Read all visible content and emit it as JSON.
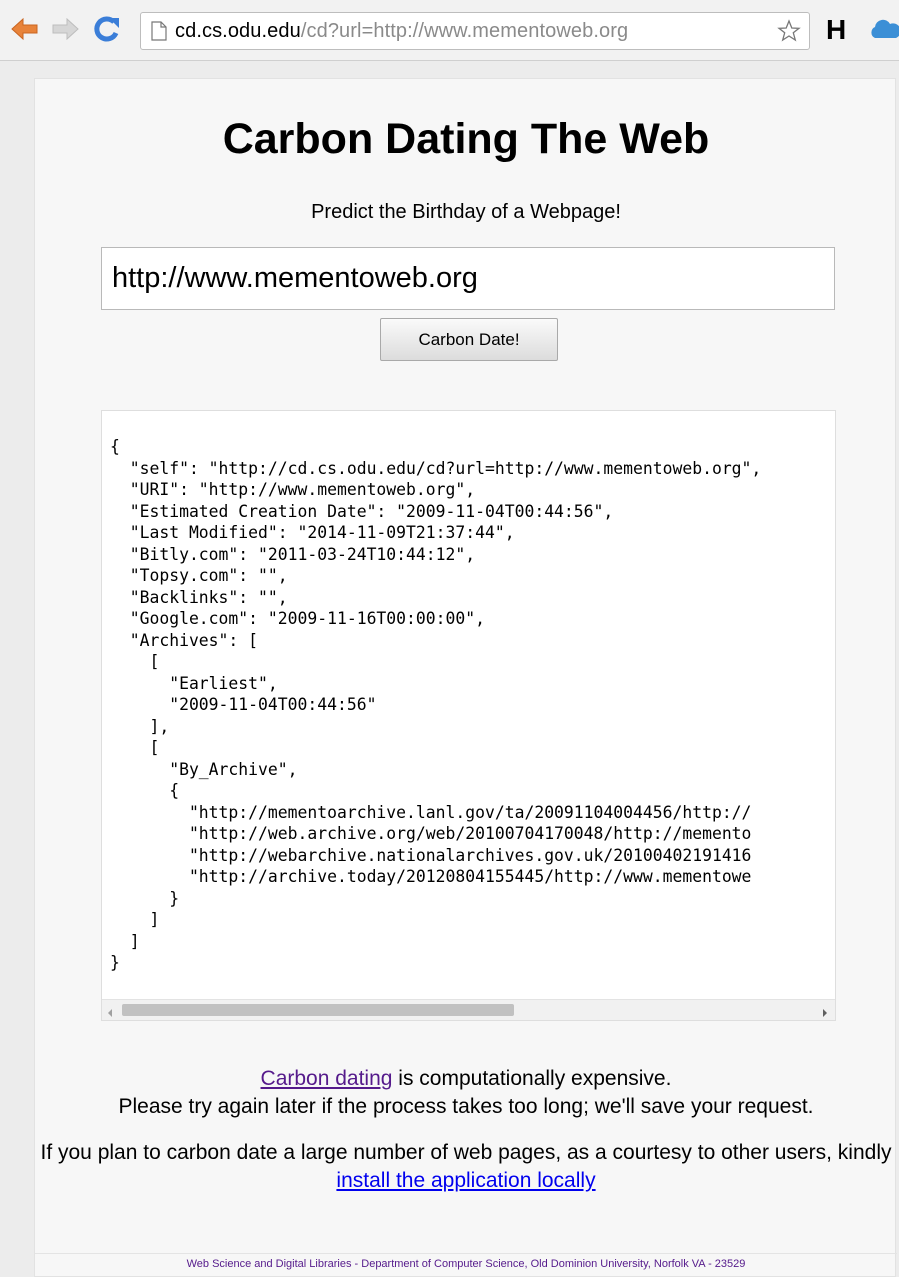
{
  "browser": {
    "url_host": "cd.cs.odu.edu",
    "url_path": "/cd?url=http://www.mementoweb.org",
    "extension_h": "H",
    "icons": [
      "back-arrow-icon",
      "forward-arrow-icon",
      "reload-icon",
      "page-icon",
      "star-icon",
      "cloud-icon"
    ]
  },
  "page": {
    "title": "Carbon Dating The Web",
    "subtitle": "Predict the Birthday of a Webpage!",
    "url_input_value": "http://www.mementoweb.org",
    "submit_label": "Carbon Date!",
    "result_lines": [
      "{",
      "  \"self\": \"http://cd.cs.odu.edu/cd?url=http://www.mementoweb.org\",",
      "  \"URI\": \"http://www.mementoweb.org\",",
      "  \"Estimated Creation Date\": \"2009-11-04T00:44:56\",",
      "  \"Last Modified\": \"2014-11-09T21:37:44\",",
      "  \"Bitly.com\": \"2011-03-24T10:44:12\",",
      "  \"Topsy.com\": \"\",",
      "  \"Backlinks\": \"\",",
      "  \"Google.com\": \"2009-11-16T00:00:00\",",
      "  \"Archives\": [",
      "    [",
      "      \"Earliest\",",
      "      \"2009-11-04T00:44:56\"",
      "    ],",
      "    [",
      "      \"By_Archive\",",
      "      {",
      "        \"http://mementoarchive.lanl.gov/ta/20091104004456/http://",
      "        \"http://web.archive.org/web/20100704170048/http://memento",
      "        \"http://webarchive.nationalarchives.gov.uk/20100402191416",
      "        \"http://archive.today/20120804155445/http://www.mementowe",
      "      }",
      "    ]",
      "  ]",
      "}"
    ],
    "notice": {
      "link1": "Carbon dating",
      "line1_rest": " is computationally expensive.",
      "line2": "Please try again later if the process takes too long; we'll save your request.",
      "para2_text": "If you plan to carbon date a large number of web pages, as a courtesy to other users, kindly ",
      "link2": "install the application locally"
    },
    "footer": "Web Science and Digital Libraries - Department of Computer Science, Old Dominion University, Norfolk VA - 23529"
  },
  "colors": {
    "back_arrow": "#e8833a",
    "forward_arrow": "#c8c8c8",
    "reload": "#3b7ed8",
    "cloud": "#3b8fd6",
    "visited_link": "#551a8b",
    "link": "#0000ee"
  }
}
